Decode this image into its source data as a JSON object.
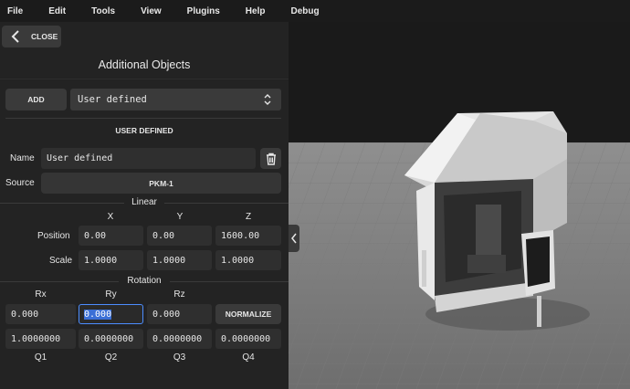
{
  "menu": {
    "items": [
      {
        "label": "File"
      },
      {
        "label": "Edit"
      },
      {
        "label": "Tools"
      },
      {
        "label": "View"
      },
      {
        "label": "Plugins"
      },
      {
        "label": "Help"
      },
      {
        "label": "Debug"
      }
    ]
  },
  "panel": {
    "close_label": "CLOSE",
    "title": "Additional Objects",
    "add_label": "ADD",
    "dropdown_value": "User defined",
    "section_title": "USER DEFINED",
    "name_label": "Name",
    "name_value": "User defined",
    "source_label": "Source",
    "source_value": "PKM-1",
    "linear_title": "Linear",
    "col_x": "X",
    "col_y": "Y",
    "col_z": "Z",
    "position_label": "Position",
    "position": {
      "x": "0.00",
      "y": "0.00",
      "z": "1600.00"
    },
    "scale_label": "Scale",
    "scale": {
      "x": "1.0000",
      "y": "1.0000",
      "z": "1.0000"
    },
    "rotation_title": "Rotation",
    "col_rx": "Rx",
    "col_ry": "Ry",
    "col_rz": "Rz",
    "rot": {
      "rx": "0.000",
      "ry": "0.000",
      "rz": "0.000"
    },
    "normalize_label": "NORMALIZE",
    "quat": {
      "q1": "1.0000000",
      "q2": "0.0000000",
      "q3": "0.0000000",
      "q4": "0.0000000"
    },
    "col_q1": "Q1",
    "col_q2": "Q2",
    "col_q3": "Q3",
    "col_q4": "Q4"
  },
  "colors": {
    "panel_bg": "#232323",
    "accent": "#3a6fd6"
  }
}
